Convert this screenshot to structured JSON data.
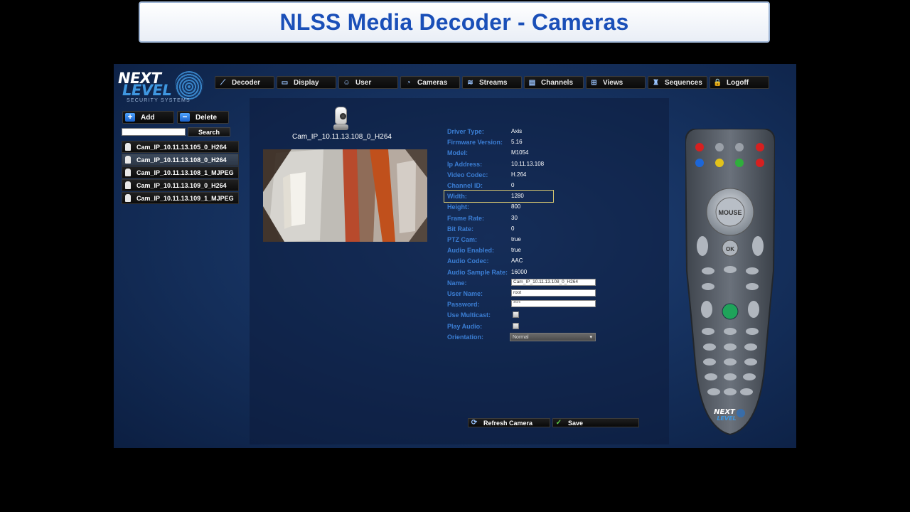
{
  "banner": {
    "title": "NLSS Media Decoder - Cameras"
  },
  "logo": {
    "line1": "NEXT",
    "line2": "LEVEL",
    "line3": "SECURITY SYSTEMS"
  },
  "menu": [
    {
      "label": "Decoder",
      "icon": "decoder-icon"
    },
    {
      "label": "Display",
      "icon": "display-icon"
    },
    {
      "label": "User",
      "icon": "user-icon"
    },
    {
      "label": "Cameras",
      "icon": "camera-icon"
    },
    {
      "label": "Streams",
      "icon": "streams-icon"
    },
    {
      "label": "Channels",
      "icon": "channels-icon"
    },
    {
      "label": "Views",
      "icon": "views-icon"
    },
    {
      "label": "Sequences",
      "icon": "sequences-icon"
    },
    {
      "label": "Logoff",
      "icon": "lock-icon"
    }
  ],
  "sidebar": {
    "add_label": "Add",
    "delete_label": "Delete",
    "search_label": "Search",
    "search_value": "",
    "cameras": [
      "Cam_IP_10.11.13.105_0_H264",
      "Cam_IP_10.11.13.108_0_H264",
      "Cam_IP_10.11.13.108_1_MJPEG",
      "Cam_IP_10.11.13.109_0_H264",
      "Cam_IP_10.11.13.109_1_MJPEG"
    ]
  },
  "camera": {
    "title": "Cam_IP_10.11.13.108_0_H264",
    "properties": [
      {
        "label": "Driver Type:",
        "value": "Axis"
      },
      {
        "label": "Firmware Version:",
        "value": "5.16"
      },
      {
        "label": "Model:",
        "value": "M1054"
      },
      {
        "label": "Ip Address:",
        "value": "10.11.13.108"
      },
      {
        "label": "Video Codec:",
        "value": "H.264"
      },
      {
        "label": "Channel ID:",
        "value": "0"
      },
      {
        "label": "Width:",
        "value": "1280"
      },
      {
        "label": "Height:",
        "value": "800"
      },
      {
        "label": "Frame Rate:",
        "value": "30"
      },
      {
        "label": "Bit Rate:",
        "value": "0"
      },
      {
        "label": "PTZ Cam:",
        "value": "true"
      },
      {
        "label": "Audio Enabled:",
        "value": "true"
      },
      {
        "label": "Audio Codec:",
        "value": "AAC"
      },
      {
        "label": "Audio Sample Rate:",
        "value": "16000"
      }
    ],
    "name_label": "Name:",
    "name_value": "Cam_IP_10.11.13.108_0_H264",
    "username_label": "User Name:",
    "username_value": "root",
    "password_label": "Password:",
    "password_value": "****",
    "multicast_label": "Use Multicast:",
    "play_audio_label": "Play Audio:",
    "orientation_label": "Orientation:",
    "orientation_value": "Normal",
    "refresh_label": "Refresh Camera",
    "save_label": "Save"
  },
  "remote": {
    "ok_label": "OK",
    "mouse_label": "MOUSE",
    "brand_line1": "NEXT",
    "brand_line2": "LEVEL"
  }
}
